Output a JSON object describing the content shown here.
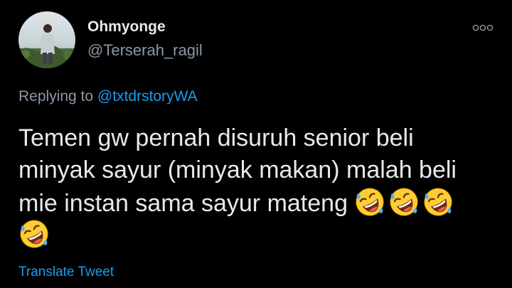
{
  "author": {
    "display_name": "Ohmyonge",
    "handle": "@Terserah_ragil"
  },
  "reply_context": {
    "prefix": "Replying to ",
    "mention": "@txtdrstoryWA"
  },
  "tweet": {
    "lines": [
      "Temen gw pernah disuruh senior beli",
      "minyak sayur (minyak makan) malah beli",
      "mie instan sama sayur mateng "
    ],
    "emoji_name": "rolling-on-the-floor-laughing",
    "emoji_count": 4
  },
  "actions": {
    "translate_label": "Translate Tweet",
    "more_icon": "more-options-icon"
  },
  "colors": {
    "background": "#000000",
    "primary_text": "#e7e9ea",
    "secondary_text": "#8b98a5",
    "accent": "#1d9bf0"
  }
}
